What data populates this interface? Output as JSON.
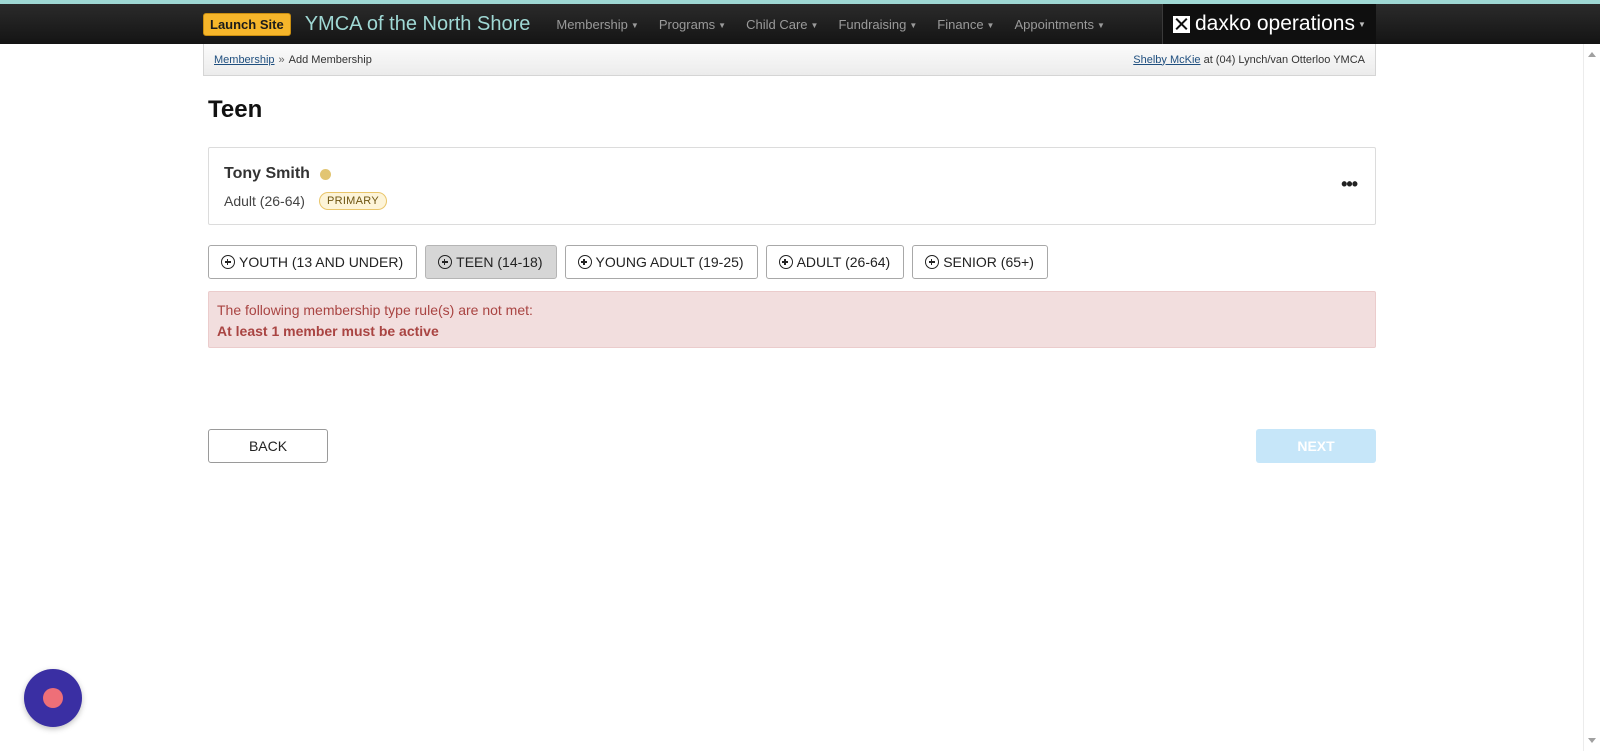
{
  "navbar": {
    "launch_label": "Launch Site",
    "site_title": "YMCA of the North Shore",
    "menu": [
      {
        "label": "Membership"
      },
      {
        "label": "Programs"
      },
      {
        "label": "Child Care"
      },
      {
        "label": "Fundraising"
      },
      {
        "label": "Finance"
      },
      {
        "label": "Appointments"
      }
    ],
    "brand": "daxko operations"
  },
  "breadcrumb": {
    "parent": "Membership",
    "separator": "»",
    "current": "Add Membership",
    "user_name": "Shelby McKie",
    "location_text": "at (04) Lynch/van Otterloo YMCA"
  },
  "page": {
    "title": "Teen"
  },
  "member": {
    "name": "Tony Smith",
    "age_group": "Adult (26-64)",
    "badge": "PRIMARY",
    "more_label": "•••"
  },
  "member_types": [
    {
      "label": "YOUTH (13 AND UNDER)",
      "active": false
    },
    {
      "label": "TEEN (14-18)",
      "active": true
    },
    {
      "label": "YOUNG ADULT (19-25)",
      "active": false
    },
    {
      "label": "ADULT (26-64)",
      "active": false
    },
    {
      "label": "SENIOR (65+)",
      "active": false
    }
  ],
  "alert": {
    "message": "The following membership type rule(s) are not met:",
    "rule": "At least 1 member must be active"
  },
  "actions": {
    "back_label": "BACK",
    "next_label": "NEXT"
  },
  "colors": {
    "accent_teal": "#9fd8d4",
    "launch_orange": "#f5b52a",
    "alert_bg": "#f2dede",
    "alert_text": "#a94442",
    "next_disabled": "#c6e6f9",
    "fab_bg": "#3a2fa3",
    "fab_dot": "#ee6f78"
  }
}
